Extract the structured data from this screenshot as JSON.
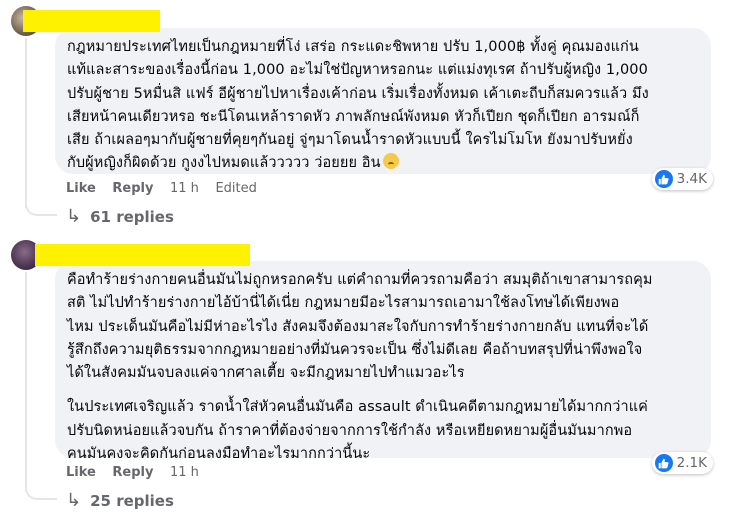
{
  "comments": [
    {
      "text": "กฎหมายประเทศไทยเป็นกฎหมายที่โง่ เสร่อ กระแดะชิพหาย ปรับ 1,000฿ ทั้งคู่ คุณมองแก่น\nแท้และสาระของเรื่องนี้ก่อน 1,000 อะไม่ใช่ปัญหาหรอกนะ แต่แม่งทุเรศ ถ้าปรับผู้หญิง 1,000\nปรับผู้ชาย 5หมื่นสิ แฟร์ อีผู้ชายไปหาเรื่องเค้าก่อน เริ่มเรื่องทั้งหมด เค้าเตะถีบก็สมควรแล้ว มึง\nเสียหน้าคนเดียวหรอ ชะนีโดนเหล้าราดหัว ภาพลักษณ์พังหมด หัวก็เปียก ชุดก็เปียก อารมณ์ก็\nเสีย ถ้าเผลอๆมากับผู้ชายที่คุยๆกันอยู่ จู่ๆมาโดนน้ำราดหัวแบบนี้ ใครไม่โมโห ยังมาปรับหยั่ง\nกับผู้หญิงก็ผิดด้วย กูงงไปหมดแล้ววววว ว่อยยย อิน",
      "like": "Like",
      "reply": "Reply",
      "time": "11 h",
      "edited": "Edited",
      "reactions": "3.4K",
      "replies": "61 replies"
    },
    {
      "text": "คือทำร้ายร่างกายคนอื่นมันไม่ถูกหรอกครับ แต่คำถามที่ควรถามคือว่า สมมุติถ้าเขาสามารถคุม\nสติ ไม่ไปทำร้ายร่างกายไอ้บ้านี่ได้เนี่ย กฎหมายมีอะไรสามารถเอามาใช้ลงโทษได้เพียงพอ\nไหม ประเด็นมันคือไม่มีห่าอะไรไง สังคมจึงต้องมาสะใจกับการทำร้ายร่างกายกลับ แทนที่จะได้\nรู้สึกถึงความยุติธรรมจากกฎหมายอย่างที่มันควรจะเป็น ซึ่งไม่ดีเลย คือถ้าบทสรุปที่น่าพึงพอใจ\nได้ในสังคมมันจบลงแค่จากศาลเตี้ย จะมีกฎหมายไปทำแมวอะไร",
      "text2": "ในประเทศเจริญแล้ว ราดน้ำใส่หัวคนอื่นมันคือ assault ดำเนินคดีตามกฎหมายได้มากกว่าแค่\nปรับนิดหน่อยแล้วจบกัน ถ้าราคาที่ต้องจ่ายจากการใช้กำลัง หรือเหยียดหยามผู้อื่นมันมากพอ\nคนมันคงจะคิดกันก่อนลงมือทำอะไรมากกว่านี้นะ",
      "like": "Like",
      "reply": "Reply",
      "time": "11 h",
      "reactions": "2.1K",
      "replies": "25 replies"
    }
  ],
  "colors": {
    "bubble": "#f0f2f5",
    "meta": "#65676b",
    "like_blue": "#1877f2",
    "redaction": "#fff200"
  },
  "icons": {
    "reaction": "thumbs-up-icon",
    "reply_arrow": "reply-arrow-icon",
    "emoji": "crying-face-emoji"
  }
}
